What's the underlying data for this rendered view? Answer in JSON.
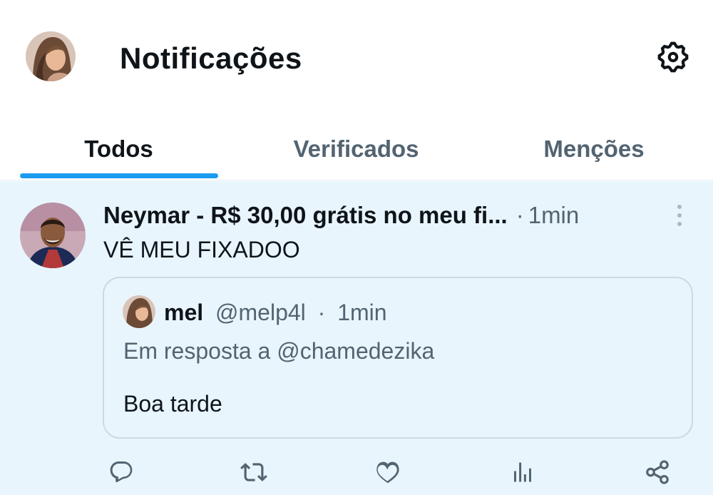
{
  "header": {
    "title": "Notificações",
    "user_avatar_alt": "profile-avatar",
    "settings_icon": "gear-icon"
  },
  "tabs": [
    {
      "label": "Todos",
      "active": true
    },
    {
      "label": "Verificados",
      "active": false
    },
    {
      "label": "Menções",
      "active": false
    }
  ],
  "notification": {
    "author_name": "Neymar - R$ 30,00 grátis no meu fi...",
    "separator": "·",
    "time": "1min",
    "text": "VÊ MEU FIXADOO",
    "quote": {
      "name": "mel",
      "handle": "@melp4l",
      "separator": "·",
      "time": "1min",
      "reply_to": "Em resposta a @chamedezika",
      "text": "Boa tarde"
    },
    "actions": [
      "reply-icon",
      "retweet-icon",
      "like-icon",
      "views-icon",
      "share-icon"
    ]
  },
  "colors": {
    "accent": "#1d9bf0",
    "unread_background": "#e8f5fd",
    "secondary_text": "#536471",
    "primary_text": "#0f1419"
  }
}
